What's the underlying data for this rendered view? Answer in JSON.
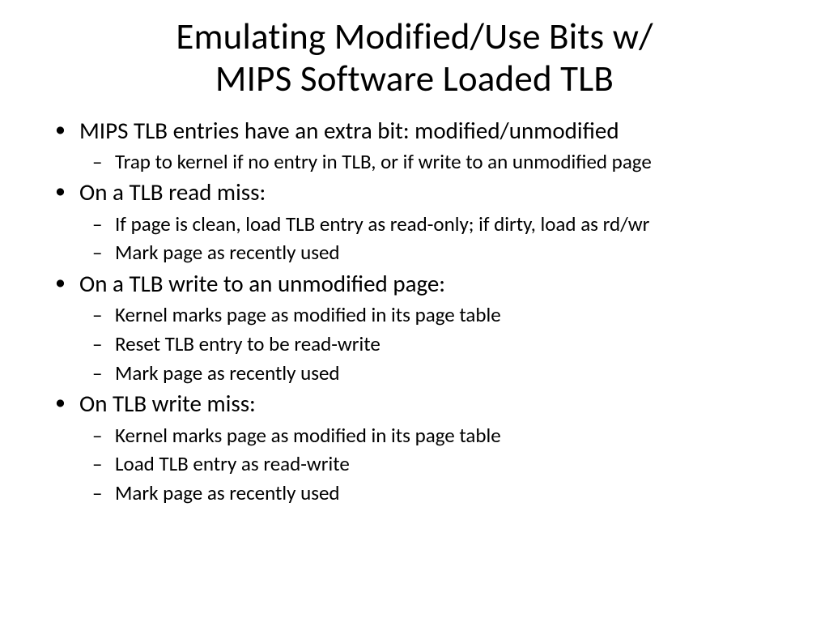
{
  "title_line1": "Emulating Modified/Use Bits w/",
  "title_line2": "MIPS Software Loaded TLB",
  "bullets": [
    {
      "text": "MIPS TLB entries have an extra bit: modified/unmodified",
      "sub": [
        "Trap to kernel if no entry in TLB, or if write to an unmodified page"
      ]
    },
    {
      "text": "On a TLB read miss:",
      "sub": [
        "If page is clean, load TLB entry as read-only; if dirty, load as rd/wr",
        "Mark page as recently used"
      ]
    },
    {
      "text": "On a TLB write to an unmodified page:",
      "sub": [
        "Kernel marks page as modified in its page table",
        "Reset TLB entry to be read-write",
        "Mark page as recently used"
      ]
    },
    {
      "text": "On TLB write miss:",
      "sub": [
        "Kernel marks page as modified in its page table",
        "Load TLB entry as read-write",
        "Mark page as recently used"
      ]
    }
  ]
}
